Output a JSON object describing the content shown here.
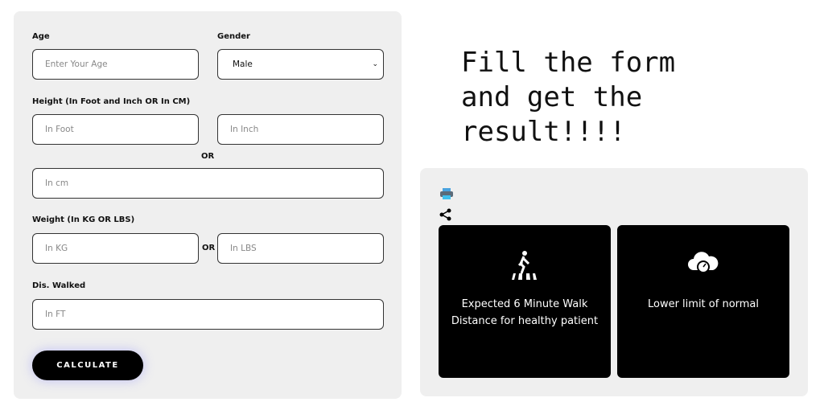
{
  "form": {
    "age_label": "Age",
    "age_placeholder": "Enter Your Age",
    "gender_label": "Gender",
    "gender_value": "Male",
    "height_label": "Height (In Foot and Inch OR In CM)",
    "foot_placeholder": "In Foot",
    "inch_placeholder": "In Inch",
    "or1": "OR",
    "cm_placeholder": "In cm",
    "weight_label": "Weight (In KG OR LBS)",
    "kg_placeholder": "In KG",
    "or2": "OR",
    "lbs_placeholder": "In LBS",
    "dist_label": "Dis. Walked",
    "ft_placeholder": "In FT",
    "calculate_label": "CALCULATE"
  },
  "heading": "Fill the form\nand get the\nresult!!!!",
  "results": {
    "icons": [
      "printer-icon",
      "share-icon"
    ],
    "cards": [
      {
        "icon": "pedestrian-crossing-icon",
        "text": "Expected 6 Minute Walk Distance for healthy patient"
      },
      {
        "icon": "cloud-speedometer-icon",
        "text": "Lower limit of normal"
      }
    ]
  }
}
